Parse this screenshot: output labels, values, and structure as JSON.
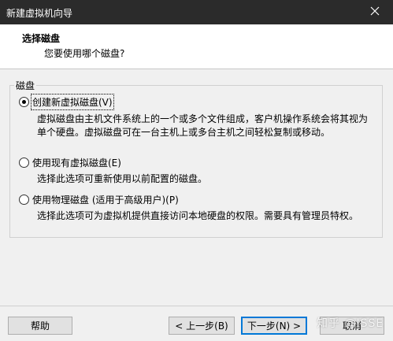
{
  "window": {
    "title": "新建虚拟机向导"
  },
  "header": {
    "title": "选择磁盘",
    "subtitle": "您要使用哪个磁盘?"
  },
  "group": {
    "label": "磁盘"
  },
  "options": [
    {
      "label": "创建新虚拟磁盘(V)",
      "desc1": "虚拟磁盘由主机文件系统上的一个或多个文件组成，客户机操作系统会将其视为",
      "desc2": "单个硬盘。虚拟磁盘可在一台主机上或多台主机之间轻松复制或移动。",
      "checked": true
    },
    {
      "label": "使用现有虚拟磁盘(E)",
      "desc1": "选择此选项可重新使用以前配置的磁盘。",
      "checked": false
    },
    {
      "label": "使用物理磁盘 (适用于高级用户)(P)",
      "desc1": "选择此选项可为虚拟机提供直接访问本地硬盘的权限。需要具有管理员特权。",
      "checked": false
    }
  ],
  "buttons": {
    "help": "帮助",
    "back": "< 上一步(B)",
    "next": "下一步(N) >",
    "cancel": "取消"
  },
  "watermark": "知乎 @ISSE",
  "icons": {
    "close": "close-icon"
  }
}
